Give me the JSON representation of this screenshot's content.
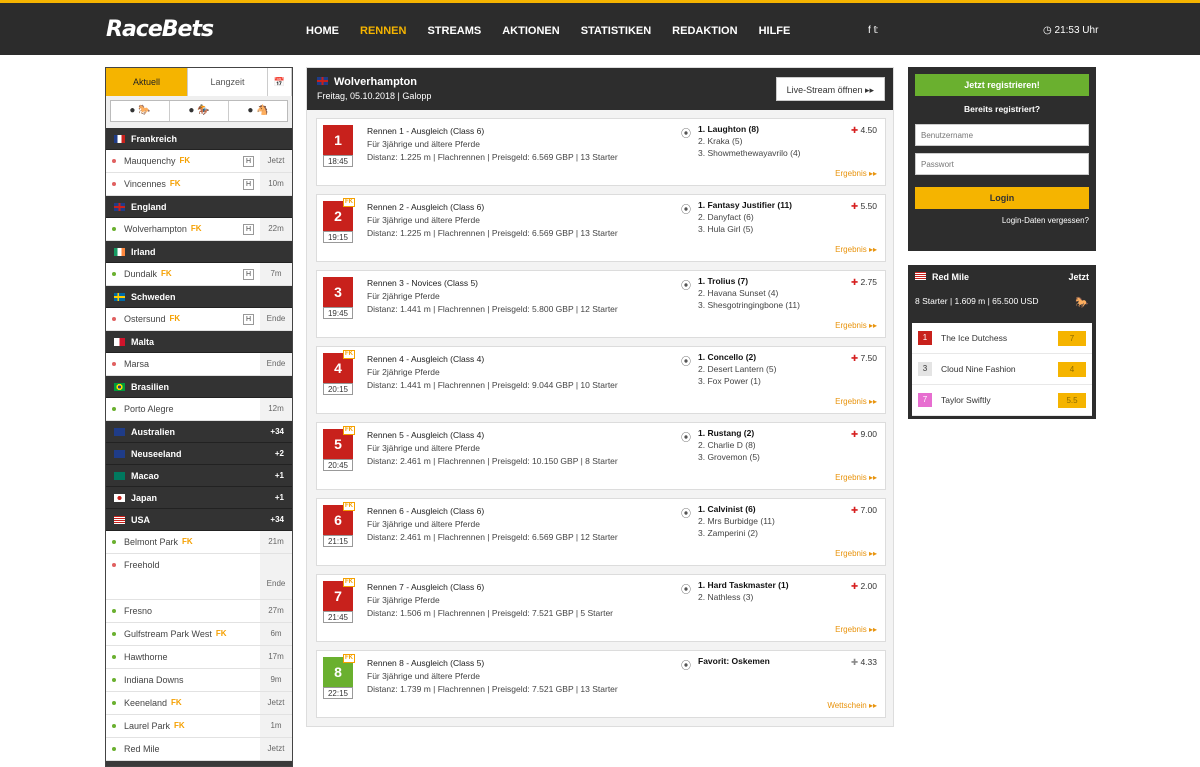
{
  "header": {
    "logo": "RaceBets",
    "nav": [
      "HOME",
      "RENNEN",
      "STREAMS",
      "AKTIONEN",
      "STATISTIKEN",
      "REDAKTION",
      "HILFE"
    ],
    "social": "f  𝕥",
    "clock": "◷ 21:53 Uhr"
  },
  "sidebar": {
    "tabs": [
      "Aktuell",
      "Langzeit",
      "📅"
    ],
    "types": [
      "● 🐎",
      "● 🏇",
      "● 🐴"
    ],
    "groups": [
      {
        "country": "Frankreich",
        "flag": "fr",
        "tracks": [
          {
            "name": "Mauquenchy",
            "fk": "FK",
            "h": "H",
            "time": "Jetzt",
            "dot": "#e06060"
          },
          {
            "name": "Vincennes",
            "fk": "FK",
            "h": "H",
            "time": "10m",
            "dot": "#e06060"
          }
        ]
      },
      {
        "country": "England",
        "flag": "gb",
        "tracks": [
          {
            "name": "Wolverhampton",
            "fk": "FK",
            "h": "H",
            "time": "22m",
            "dot": "#6ab02f"
          }
        ]
      },
      {
        "country": "Irland",
        "flag": "ie",
        "tracks": [
          {
            "name": "Dundalk",
            "fk": "FK",
            "h": "H",
            "time": "7m",
            "dot": "#6ab02f"
          }
        ]
      },
      {
        "country": "Schweden",
        "flag": "se",
        "tracks": [
          {
            "name": "Ostersund",
            "fk": "FK",
            "h": "H",
            "time": "Ende",
            "dot": "#e06060"
          }
        ]
      },
      {
        "country": "Malta",
        "flag": "mt",
        "tracks": [
          {
            "name": "Marsa",
            "fk": "",
            "h": "",
            "time": "Ende",
            "dot": "#e06060"
          }
        ]
      },
      {
        "country": "Brasilien",
        "flag": "br",
        "tracks": [
          {
            "name": "Porto Alegre",
            "fk": "",
            "h": "",
            "time": "12m",
            "dot": "#6ab02f"
          }
        ]
      },
      {
        "country": "Australien",
        "flag": "au",
        "count": "+34",
        "tracks": []
      },
      {
        "country": "Neuseeland",
        "flag": "nz",
        "count": "+2",
        "tracks": []
      },
      {
        "country": "Macao",
        "flag": "mo",
        "count": "+1",
        "tracks": []
      },
      {
        "country": "Japan",
        "flag": "jp",
        "count": "+1",
        "tracks": []
      },
      {
        "country": "USA",
        "flag": "us",
        "count": "+34",
        "tracks": [
          {
            "name": "Belmont Park",
            "fk": "FK",
            "h": "",
            "time": "21m",
            "dot": "#6ab02f"
          },
          {
            "name": "Freehold",
            "fk": "",
            "h": "",
            "time": "Ende",
            "dot": "#e06060",
            "tall": true
          },
          {
            "name": "Fresno",
            "fk": "",
            "h": "",
            "time": "27m",
            "dot": "#6ab02f"
          },
          {
            "name": "Gulfstream Park West",
            "fk": "FK",
            "h": "",
            "time": "6m",
            "dot": "#6ab02f"
          },
          {
            "name": "Hawthorne",
            "fk": "",
            "h": "",
            "time": "17m",
            "dot": "#6ab02f"
          },
          {
            "name": "Indiana Downs",
            "fk": "",
            "h": "",
            "time": "9m",
            "dot": "#6ab02f"
          },
          {
            "name": "Keeneland",
            "fk": "FK",
            "h": "",
            "time": "Jetzt",
            "dot": "#6ab02f"
          },
          {
            "name": "Laurel Park",
            "fk": "FK",
            "h": "",
            "time": "1m",
            "dot": "#6ab02f"
          },
          {
            "name": "Red Mile",
            "fk": "",
            "h": "",
            "time": "Jetzt",
            "dot": "#6ab02f"
          }
        ]
      }
    ]
  },
  "main": {
    "title": "Wolverhampton",
    "subtitle": "Freitag, 05.10.2018  |  Galopp",
    "live_button": "Live-Stream öffnen ▸▸",
    "races": [
      {
        "num": "1",
        "fk": false,
        "time": "18:45",
        "color": "red",
        "title": "Rennen 1 - Ausgleich (Class 6)",
        "cond": "Für 3jährige und ältere Pferde",
        "meta": "Distanz: 1.225 m  |  Flachrennen  |  Preisgeld: 6.569 GBP  |  13 Starter",
        "runners": [
          "1. Laughton (8)",
          "2. Kraka (5)",
          "3. Showmethewayavrilo (4)"
        ],
        "odds": "4.50",
        "link": "Ergebnis ▸▸"
      },
      {
        "num": "2",
        "fk": true,
        "time": "19:15",
        "color": "red",
        "title": "Rennen 2 - Ausgleich (Class 6)",
        "cond": "Für 3jährige und ältere Pferde",
        "meta": "Distanz: 1.225 m  |  Flachrennen  |  Preisgeld: 6.569 GBP  |  13 Starter",
        "runners": [
          "1. Fantasy Justifier (11)",
          "2. Danyfact (6)",
          "3. Hula Girl (5)"
        ],
        "odds": "5.50",
        "link": "Ergebnis ▸▸"
      },
      {
        "num": "3",
        "fk": false,
        "time": "19:45",
        "color": "red",
        "title": "Rennen 3 - Novices (Class 5)",
        "cond": "Für 2jährige Pferde",
        "meta": "Distanz: 1.441 m  |  Flachrennen  |  Preisgeld: 5.800 GBP  |  12 Starter",
        "runners": [
          "1. Trolius (7)",
          "2. Havana Sunset (4)",
          "3. Shesgotringingbone (11)"
        ],
        "odds": "2.75",
        "link": "Ergebnis ▸▸"
      },
      {
        "num": "4",
        "fk": true,
        "time": "20:15",
        "color": "red",
        "title": "Rennen 4 - Ausgleich (Class 4)",
        "cond": "Für 2jährige Pferde",
        "meta": "Distanz: 1.441 m  |  Flachrennen  |  Preisgeld: 9.044 GBP  |  10 Starter",
        "runners": [
          "1. Concello (2)",
          "2. Desert Lantern (5)",
          "3. Fox Power (1)"
        ],
        "odds": "7.50",
        "link": "Ergebnis ▸▸"
      },
      {
        "num": "5",
        "fk": true,
        "time": "20:45",
        "color": "red",
        "title": "Rennen 5 - Ausgleich (Class 4)",
        "cond": "Für 3jährige und ältere Pferde",
        "meta": "Distanz: 2.461 m  |  Flachrennen  |  Preisgeld: 10.150 GBP  |  8 Starter",
        "runners": [
          "1. Rustang (2)",
          "2. Charlie D (8)",
          "3. Grovemon (5)"
        ],
        "odds": "9.00",
        "link": "Ergebnis ▸▸"
      },
      {
        "num": "6",
        "fk": true,
        "time": "21:15",
        "color": "red",
        "title": "Rennen 6 - Ausgleich (Class 6)",
        "cond": "Für 3jährige und ältere Pferde",
        "meta": "Distanz: 2.461 m  |  Flachrennen  |  Preisgeld: 6.569 GBP  |  12 Starter",
        "runners": [
          "1. Calvinist (6)",
          "2. Mrs Burbidge (11)",
          "3. Zamperini (2)"
        ],
        "odds": "7.00",
        "link": "Ergebnis ▸▸"
      },
      {
        "num": "7",
        "fk": true,
        "time": "21:45",
        "color": "red",
        "title": "Rennen 7 - Ausgleich (Class 6)",
        "cond": "Für 3jährige Pferde",
        "meta": "Distanz: 1.506 m  |  Flachrennen  |  Preisgeld: 7.521 GBP  |  5 Starter",
        "runners": [
          "1. Hard Taskmaster (1)",
          "2. Nathless (3)"
        ],
        "odds": "2.00",
        "link": "Ergebnis ▸▸"
      },
      {
        "num": "8",
        "fk": true,
        "time": "22:15",
        "color": "green",
        "title": "Rennen 8 - Ausgleich (Class 5)",
        "cond": "Für 3jährige und ältere Pferde",
        "meta": "Distanz: 1.739 m  |  Flachrennen  |  Preisgeld: 7.521 GBP  |  13 Starter",
        "runners": [
          "Favorit: Oskemen"
        ],
        "odds": "4.33",
        "link": "Wettschein ▸▸"
      }
    ]
  },
  "login": {
    "register": "Jetzt registrieren!",
    "already": "Bereits registriert?",
    "user_placeholder": "Benutzername",
    "pass_placeholder": "Passwort",
    "login_button": "Login",
    "forgot": "Login-Daten vergessen?"
  },
  "redmile": {
    "title": "Red Mile",
    "status": "Jetzt",
    "info": "8 Starter  |  1.609 m  |  65.500 USD",
    "runners": [
      {
        "num": "1",
        "name": "The Ice Dutchess",
        "odds": "7",
        "color": "#c8211c",
        "fg": "#fff"
      },
      {
        "num": "3",
        "name": "Cloud Nine Fashion",
        "odds": "4",
        "color": "#e4e4e4",
        "fg": "#333"
      },
      {
        "num": "7",
        "name": "Taylor Swiftly",
        "odds": "5.5",
        "color": "#e76ed0",
        "fg": "#fff"
      }
    ]
  },
  "colors": {
    "accent": "#f5b400",
    "green": "#6ab02f",
    "red": "#c8211c",
    "dark": "#2d2d2d"
  }
}
